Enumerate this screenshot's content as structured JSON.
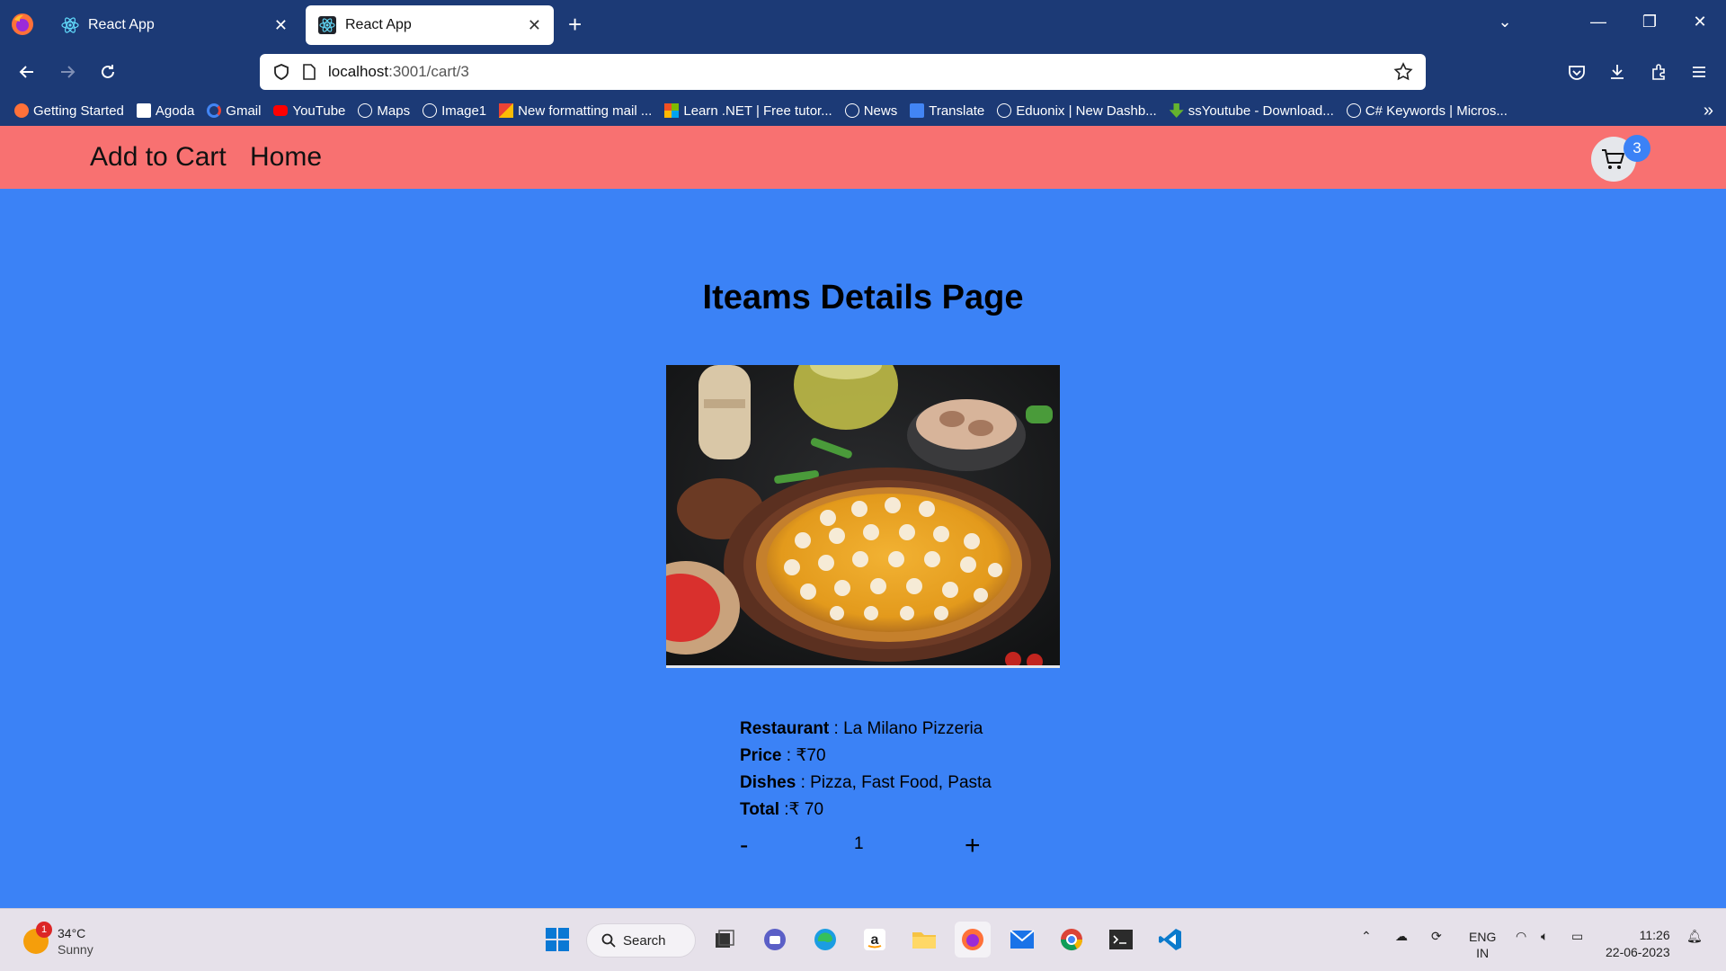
{
  "browser": {
    "tabs": [
      {
        "title": "React App",
        "active": false
      },
      {
        "title": "React App",
        "active": true
      }
    ],
    "url": {
      "host": "localhost",
      "path": ":3001/cart/3"
    },
    "bookmarks": [
      {
        "label": "Getting Started",
        "icon": "firefox-icon"
      },
      {
        "label": "Agoda",
        "icon": "agoda-icon"
      },
      {
        "label": "Gmail",
        "icon": "google-icon"
      },
      {
        "label": "YouTube",
        "icon": "youtube-icon"
      },
      {
        "label": "Maps",
        "icon": "globe-icon"
      },
      {
        "label": "Image1",
        "icon": "globe-icon"
      },
      {
        "label": "New formatting mail ...",
        "icon": "gmail-icon"
      },
      {
        "label": "Learn .NET | Free tutor...",
        "icon": "microsoft-icon"
      },
      {
        "label": "News",
        "icon": "globe-icon"
      },
      {
        "label": "Translate",
        "icon": "translate-icon"
      },
      {
        "label": "Eduonix | New Dashb...",
        "icon": "globe-icon"
      },
      {
        "label": "ssYoutube - Download...",
        "icon": "download-arrow-icon"
      },
      {
        "label": "C# Keywords | Micros...",
        "icon": "globe-icon"
      }
    ]
  },
  "app": {
    "header": {
      "brand": "Add to Cart",
      "home": "Home",
      "cart_count": "3"
    },
    "page_title": "Iteams Details Page",
    "details": {
      "restaurant_label": "Restaurant",
      "restaurant": "La Milano Pizzeria",
      "price_label": "Price",
      "price": "₹70",
      "dishes_label": "Dishes",
      "dishes": "Pizza, Fast Food, Pasta",
      "total_label": "Total",
      "total": "₹ 70"
    },
    "quantity": {
      "minus": "-",
      "value": "1",
      "plus": "+"
    }
  },
  "taskbar": {
    "weather": {
      "temp": "34°C",
      "condition": "Sunny",
      "badge": "1"
    },
    "search_label": "Search",
    "lang": [
      "ENG",
      "IN"
    ],
    "time": "11:26",
    "date": "22-06-2023"
  },
  "colors": {
    "page_bg": "#3b82f6",
    "header_bg": "#f87171",
    "chrome_bg": "#1c3a76"
  }
}
